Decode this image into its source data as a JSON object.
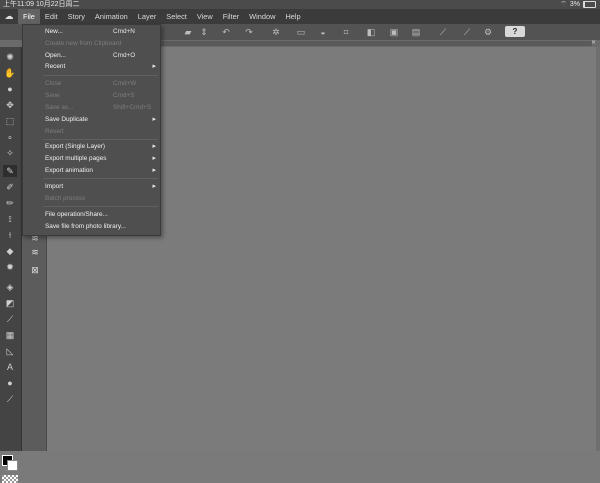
{
  "status": {
    "time": "上午11:09  10月22日周二",
    "battery": "3%"
  },
  "menubar": {
    "app_icon": "wifi-like-app-icon",
    "items": [
      "File",
      "Edit",
      "Story",
      "Animation",
      "Layer",
      "Select",
      "View",
      "Filter",
      "Window",
      "Help"
    ]
  },
  "toolbar": {
    "help": "?"
  },
  "file_menu": {
    "items": [
      {
        "label": "New...",
        "shortcut": "Cmd+N",
        "enabled": true
      },
      {
        "label": "Create new from Clipboard",
        "shortcut": "",
        "enabled": false
      },
      {
        "label": "Open...",
        "shortcut": "Cmd+O",
        "enabled": true
      },
      {
        "label": "Recent",
        "shortcut": "",
        "enabled": true,
        "submenu": true
      },
      {
        "label": "Close",
        "shortcut": "Cmd+W",
        "enabled": false
      },
      {
        "label": "Save",
        "shortcut": "Cmd+S",
        "enabled": false
      },
      {
        "label": "Save as...",
        "shortcut": "Shift+Cmd+S",
        "enabled": false
      },
      {
        "label": "Save Duplicate",
        "shortcut": "",
        "enabled": true,
        "submenu": true
      },
      {
        "label": "Revert",
        "shortcut": "",
        "enabled": false
      },
      {
        "label": "Export (Single Layer)",
        "shortcut": "",
        "enabled": true,
        "submenu": true
      },
      {
        "label": "Export multiple pages",
        "shortcut": "",
        "enabled": true,
        "submenu": true
      },
      {
        "label": "Export animation",
        "shortcut": "",
        "enabled": true,
        "submenu": true
      },
      {
        "label": "Import",
        "shortcut": "",
        "enabled": true,
        "submenu": true
      },
      {
        "label": "Batch process",
        "shortcut": "",
        "enabled": false
      },
      {
        "label": "File operation/Share...",
        "shortcut": "",
        "enabled": true
      },
      {
        "label": "Save file from photo library...",
        "shortcut": "",
        "enabled": true
      }
    ],
    "arrow": "▸"
  },
  "colors": {
    "menubar": "#3b3b3b",
    "menu_bg": "#4f4f4f",
    "canvas": "#7b7b7b"
  }
}
